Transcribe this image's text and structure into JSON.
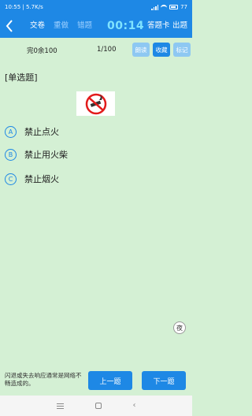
{
  "status_bar": {
    "time_speed": "10:55 | 5.7K/s",
    "battery": "77"
  },
  "nav": {
    "back_icon": "chevron-left-icon",
    "items": [
      "交卷",
      "重做",
      "错题"
    ],
    "timer": "00:14",
    "answer_card": "答题卡",
    "exit": "出题"
  },
  "info": {
    "progress": "完0余100",
    "pager": "1/100",
    "read_label": "朗读",
    "favorite_label": "收藏",
    "mark_label": "标记"
  },
  "question": {
    "type": "[单选题]",
    "image_icon": "no-fire-sign-icon"
  },
  "options": [
    {
      "letter": "A",
      "text": "禁止点火"
    },
    {
      "letter": "B",
      "text": "禁止用火柴"
    },
    {
      "letter": "C",
      "text": "禁止烟火"
    }
  ],
  "night_mode_label": "夜",
  "footer": {
    "hint": "闪退或失去响应通常是网络不畅造成的。",
    "prev_label": "上一题",
    "next_label": "下一题"
  },
  "colors": {
    "accent": "#1e88e5",
    "background": "#d4f0d4",
    "timer": "#7fe3ff"
  }
}
